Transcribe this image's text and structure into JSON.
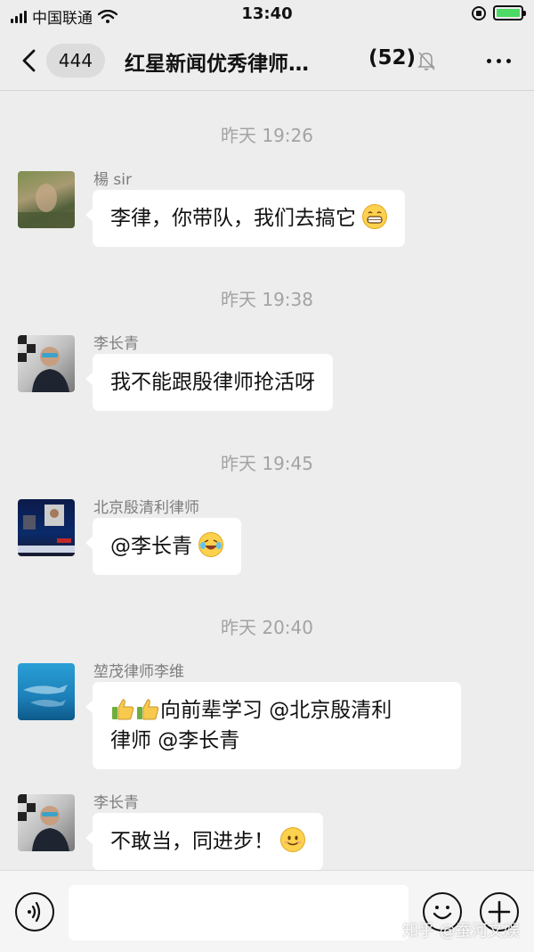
{
  "status_bar": {
    "carrier": "中国联通",
    "time": "13:40"
  },
  "nav": {
    "unread_count": "444",
    "title": "红星新闻优秀律师…",
    "member_count": "(52)"
  },
  "messages": [
    {
      "timestamp": "昨天 19:26",
      "sender": "楊 sir",
      "text": "李律，你带队，我们去搞它",
      "emoji": "grinning-face"
    },
    {
      "timestamp": "昨天 19:38",
      "sender": "李长青",
      "text": "我不能跟殷律师抢活呀"
    },
    {
      "timestamp": "昨天 19:45",
      "sender": "北京殷清利律师",
      "text": "@李长青",
      "emoji": "laughing-crying-face"
    },
    {
      "timestamp": "昨天 20:40",
      "sender": "堃茂律师李维",
      "text_line1": "向前辈学习 @北京殷清利",
      "text_line2": "律师 @李长青",
      "emoji": "thumbs-up"
    },
    {
      "sender": "李长青",
      "text": "不敢当，同进步！",
      "emoji": "smiling-face"
    }
  ],
  "watermark": "知乎 @蚕河文娱",
  "colors": {
    "background": "#ededed",
    "bubble": "#ffffff",
    "timestamp": "#a3a3a3",
    "sender": "#7d7d7d",
    "battery": "#4cd964"
  }
}
